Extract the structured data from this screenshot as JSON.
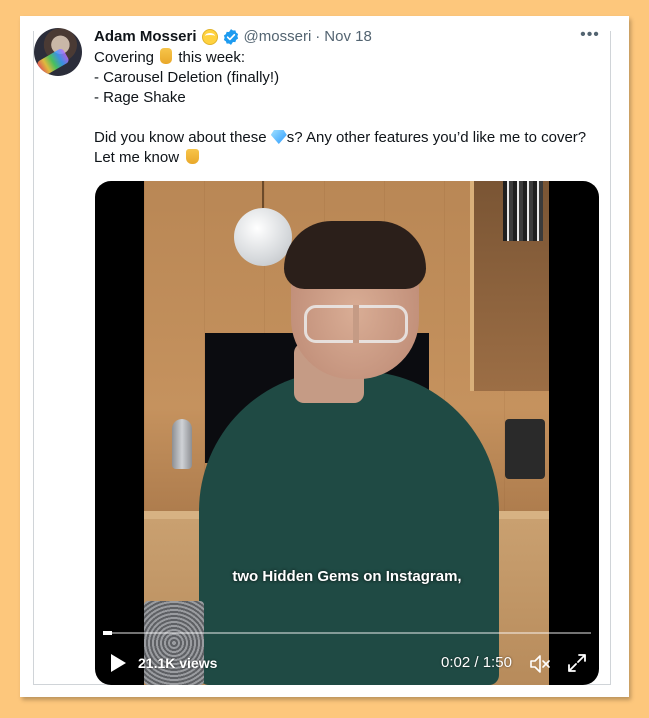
{
  "tweet": {
    "author_name": "Adam Mosseri",
    "handle": "@mosseri",
    "separator": "·",
    "date": "Nov 18",
    "more_label": "•••",
    "lines": {
      "line1_a": "Covering",
      "line1_b": "this week:",
      "line2": "- Carousel Deletion (finally!)",
      "line3": "- Rage Shake",
      "line4_a": "Did you know about these",
      "line4_b": "s? Any other features you’d like me to cover?",
      "line5": "Let me know"
    },
    "icons": {
      "badge": "smiling-face-halo-icon",
      "verified": "verified-badge-icon",
      "peace": "victory-hand-icon",
      "gem": "gem-stone-icon",
      "point": "backhand-index-pointing-down-icon"
    }
  },
  "video": {
    "caption": "two Hidden Gems on Instagram,",
    "views": "21.1K views",
    "time_current": "0:02",
    "time_separator": " / ",
    "time_total": "1:50",
    "progress_fraction": 0.018,
    "icons": {
      "play": "play-icon",
      "volume": "volume-muted-icon",
      "fullscreen": "fullscreen-icon"
    }
  },
  "colors": {
    "page_background": "#fdc77c",
    "verified_blue": "#1d9bf0",
    "text_primary": "#0f1419",
    "text_secondary": "#536471"
  }
}
